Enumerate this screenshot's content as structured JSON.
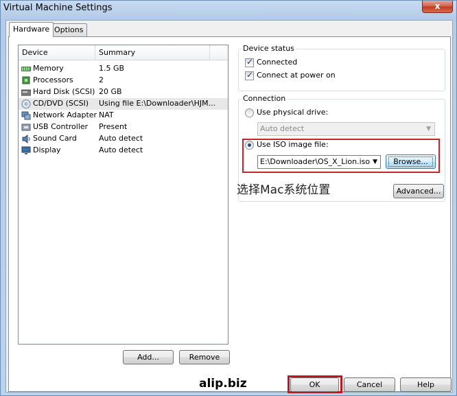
{
  "window": {
    "title": "Virtual Machine Settings",
    "close_glyph": "x"
  },
  "tabs": [
    {
      "label": "Hardware"
    },
    {
      "label": "Options"
    }
  ],
  "device_list": {
    "columns": {
      "device": "Device",
      "summary": "Summary"
    },
    "rows": [
      {
        "device": "Memory",
        "summary": "1.5 GB",
        "icon": "memory-icon"
      },
      {
        "device": "Processors",
        "summary": "2",
        "icon": "processor-icon"
      },
      {
        "device": "Hard Disk (SCSI)",
        "summary": "20 GB",
        "icon": "hard-disk-icon"
      },
      {
        "device": "CD/DVD (SCSI)",
        "summary": "Using file E:\\Downloader\\HJM...",
        "icon": "cd-dvd-icon",
        "selected": true
      },
      {
        "device": "Network Adapter",
        "summary": "NAT",
        "icon": "network-adapter-icon"
      },
      {
        "device": "USB Controller",
        "summary": "Present",
        "icon": "usb-icon"
      },
      {
        "device": "Sound Card",
        "summary": "Auto detect",
        "icon": "sound-card-icon"
      },
      {
        "device": "Display",
        "summary": "Auto detect",
        "icon": "display-icon"
      }
    ],
    "add_label": "Add...",
    "remove_label": "Remove"
  },
  "device_status": {
    "label": "Device status",
    "connected": "Connected",
    "connect_at_power_on": "Connect at power on"
  },
  "connection": {
    "label": "Connection",
    "physical_drive": "Use physical drive:",
    "auto_detect": "Auto detect",
    "iso_image": "Use ISO image file:",
    "iso_path": "E:\\Downloader\\OS_X_Lion.iso",
    "browse_label": "Browse..."
  },
  "annotation": "选择Mac系统位置",
  "advanced_label": "Advanced...",
  "footer": {
    "site": "alip.biz",
    "ok": "OK",
    "cancel": "Cancel",
    "help": "Help"
  },
  "colors": {
    "highlight_red": "#c3262f",
    "selection": "#e8e8e8"
  }
}
